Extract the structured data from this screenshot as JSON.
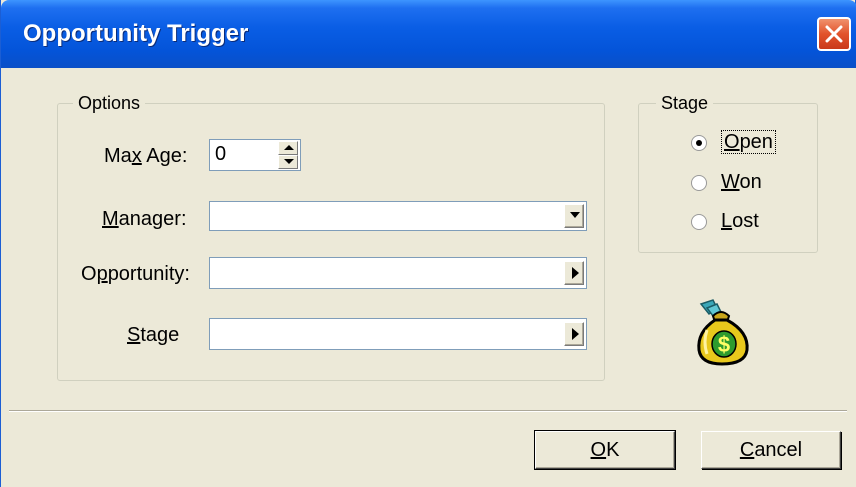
{
  "window": {
    "title": "Opportunity Trigger"
  },
  "options_group": {
    "legend": "Options",
    "max_age": {
      "label_pre": "Ma",
      "label_accel": "x",
      "label_post": " Age:",
      "value": "0"
    },
    "manager": {
      "label_accel": "M",
      "label_post": "anager:",
      "value": ""
    },
    "opportunity": {
      "label_pre": "O",
      "label_accel": "p",
      "label_post": "portunity:",
      "value": ""
    },
    "stage": {
      "label_accel": "S",
      "label_post": "tage",
      "value": ""
    }
  },
  "stage_group": {
    "legend": "Stage",
    "options": [
      {
        "accel": "O",
        "rest": "pen",
        "selected": true
      },
      {
        "accel": "W",
        "rest": "on",
        "selected": false
      },
      {
        "accel": "L",
        "rest": "ost",
        "selected": false
      }
    ]
  },
  "buttons": {
    "ok": {
      "accel": "O",
      "rest": "K"
    },
    "cancel": {
      "accel": "C",
      "rest": "ancel"
    }
  },
  "icons": {
    "close": "close-icon",
    "dropdown": "chevron-down-icon",
    "browse": "triangle-right-icon",
    "spin_up": "spin-up-icon",
    "spin_down": "spin-down-icon",
    "moneybag": "money-bag-icon"
  },
  "colors": {
    "titlebar": "#0454d9",
    "close": "#e2532b",
    "window_bg": "#ece9d8",
    "moneybag": "#e8c81c"
  }
}
